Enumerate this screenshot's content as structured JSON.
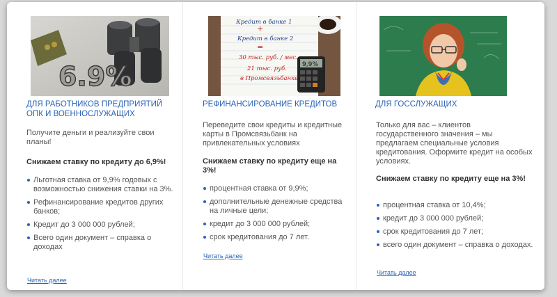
{
  "cards": [
    {
      "image_caption": "6.9%",
      "title": "ДЛЯ РАБОТНИКОВ ПРЕДПРИЯТИЙ ОПК И ВОЕННОСЛУЖАЩИХ",
      "description": "Получите деньги и реализуйте свои планы!",
      "highlight": "Снижаем ставку по кредиту до 6,9%!",
      "items": [
        "Льготная ставка от 9,9% годовых с возможностью снижения ставки на 3%.",
        "Рефинансирование кредитов других банков;",
        "Кредит до 3 000 000 рублей;",
        "Всего один документ – справка о доходах"
      ],
      "more": "Читать далее"
    },
    {
      "image_lines": [
        "Кредит в банке 1",
        "+",
        "Кредит в банке 2",
        "=",
        "30 тыс. руб. / мес.",
        "21 тыс. руб.",
        "в Промсвязьбанке"
      ],
      "image_calc": "9,9%",
      "title": "РЕФИНАНСИРОВАНИЕ КРЕДИТОВ",
      "description": "Переведите свои кредиты и кредитные карты в Промсвязьбанк на привлекательных условиях",
      "highlight": "Снижаем ставку по кредиту еще на 3%!",
      "items": [
        "процентная ставка от 9,9%;",
        "дополнительные денежные средства на личные цели;",
        "кредит до 3 000 000 рублей;",
        "срок кредитования до 7 лет."
      ],
      "more": "Читать далее"
    },
    {
      "title": "ДЛЯ ГОССЛУЖАЩИХ",
      "description": "Только для вас – клиентов государственного значения – мы предлагаем специальные условия кредитования. Оформите кредит на особых условиях.",
      "highlight": "Снижаем ставку по кредиту еще на 3%!",
      "items": [
        "процентная ставка от 10,4%;",
        "кредит до 3 000 000 рублей;",
        "срок кредитования до 7 лет;",
        "всего один документ – справка о доходах."
      ],
      "more": "Читать далее"
    }
  ]
}
